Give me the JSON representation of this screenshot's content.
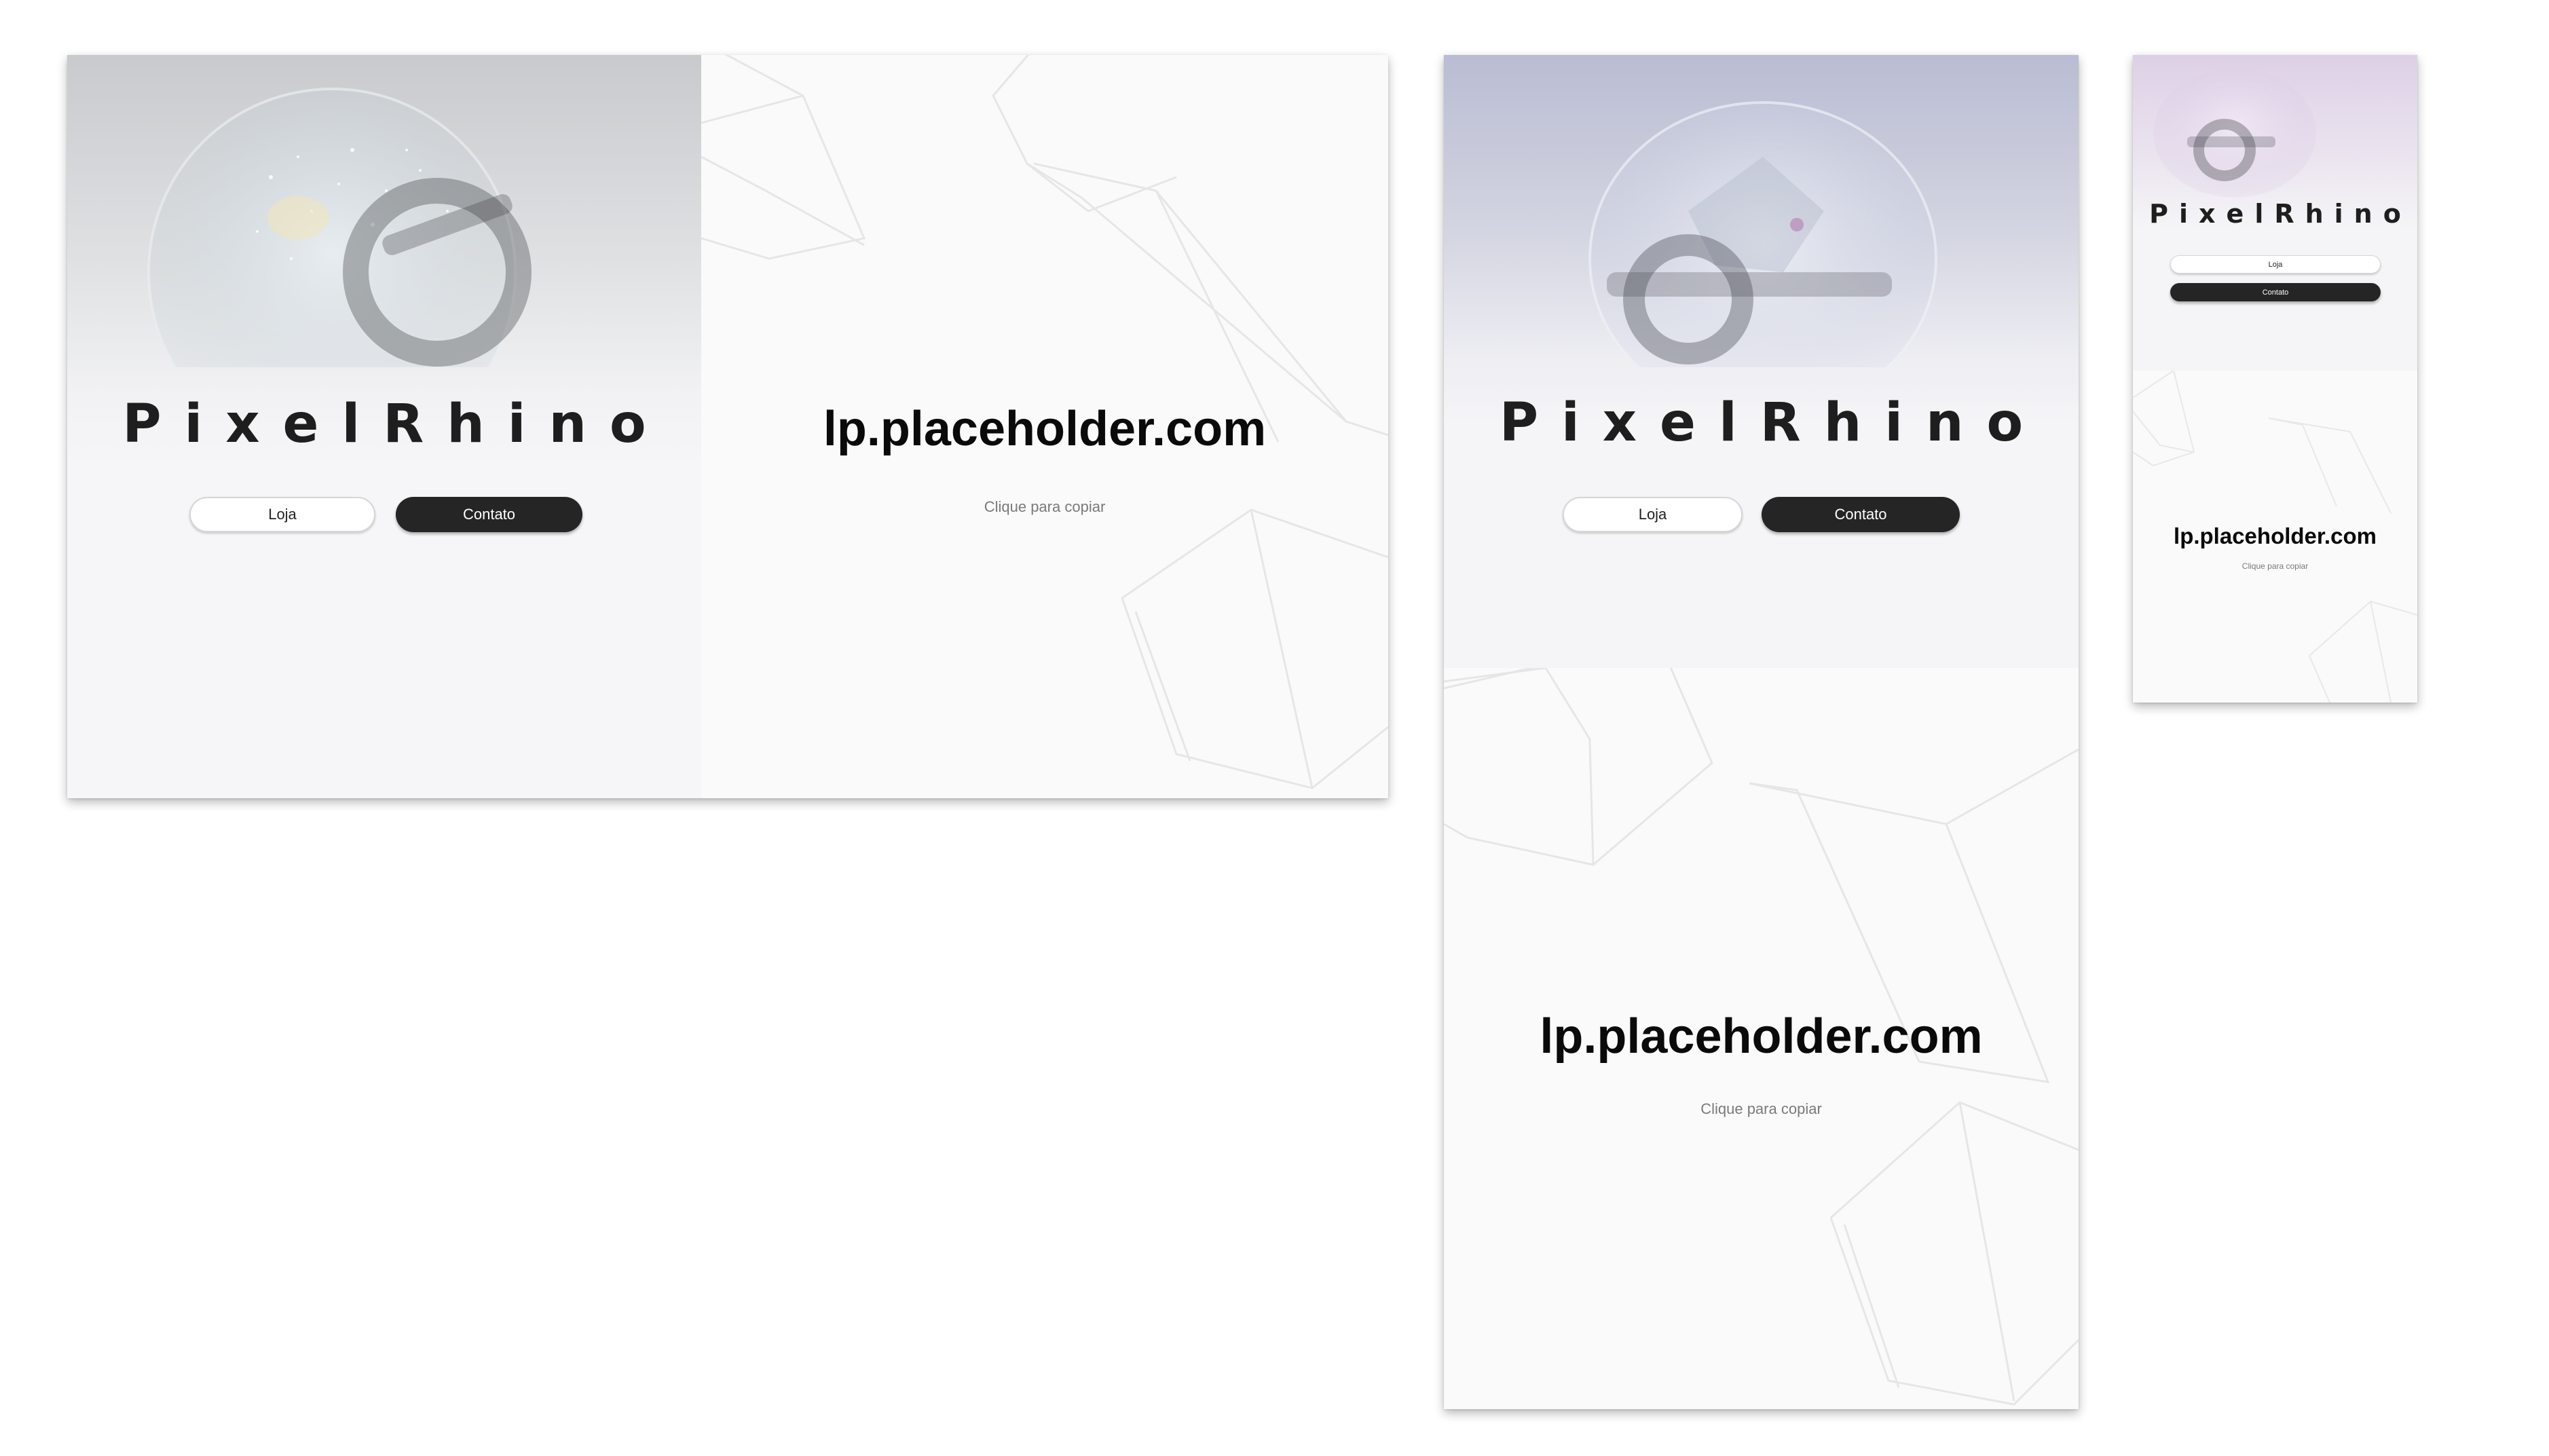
{
  "brand": {
    "name": "PixelRhino"
  },
  "nav": {
    "shop_label": "Loja",
    "contact_label": "Contato"
  },
  "server": {
    "ip": "lp.placeholder.com",
    "copy_hint": "Clique para copiar"
  },
  "colors": {
    "dark_button": "#252525",
    "page_background": "#ffffff",
    "panel_background": "#fafafa",
    "brand_text": "#1e1e1e"
  },
  "icons": {
    "hero_art": "pokeball-icon"
  }
}
